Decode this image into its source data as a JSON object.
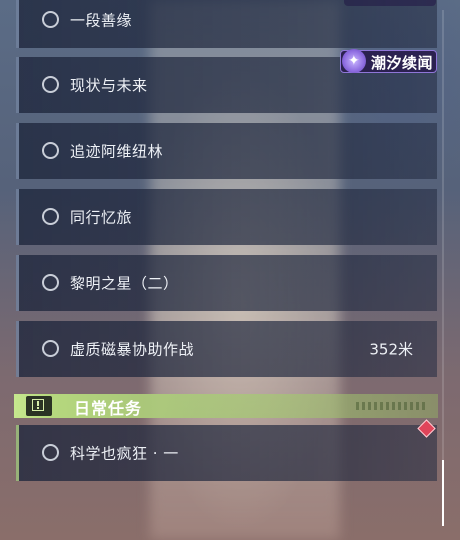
{
  "event_tag": {
    "label": "潮汐续闻",
    "icon": "sparkle-star-icon",
    "color": "#8f76d8"
  },
  "quests": [
    {
      "title": "一段善缘"
    },
    {
      "title": "现状与未来"
    },
    {
      "title": "追迹阿维纽林"
    },
    {
      "title": "同行忆旅"
    },
    {
      "title": "黎明之星（二）"
    },
    {
      "title": "虚质磁暴协助作战",
      "distance": "352米"
    }
  ],
  "daily_section": {
    "title": "日常任务",
    "icon": "exclamation-box-icon",
    "accent_color": "#c6e88e",
    "quests": [
      {
        "title": "科学也疯狂 · 一"
      }
    ]
  },
  "markers": {
    "tracked_icon": "red-diamond-marker-icon",
    "color": "#e0455a"
  }
}
